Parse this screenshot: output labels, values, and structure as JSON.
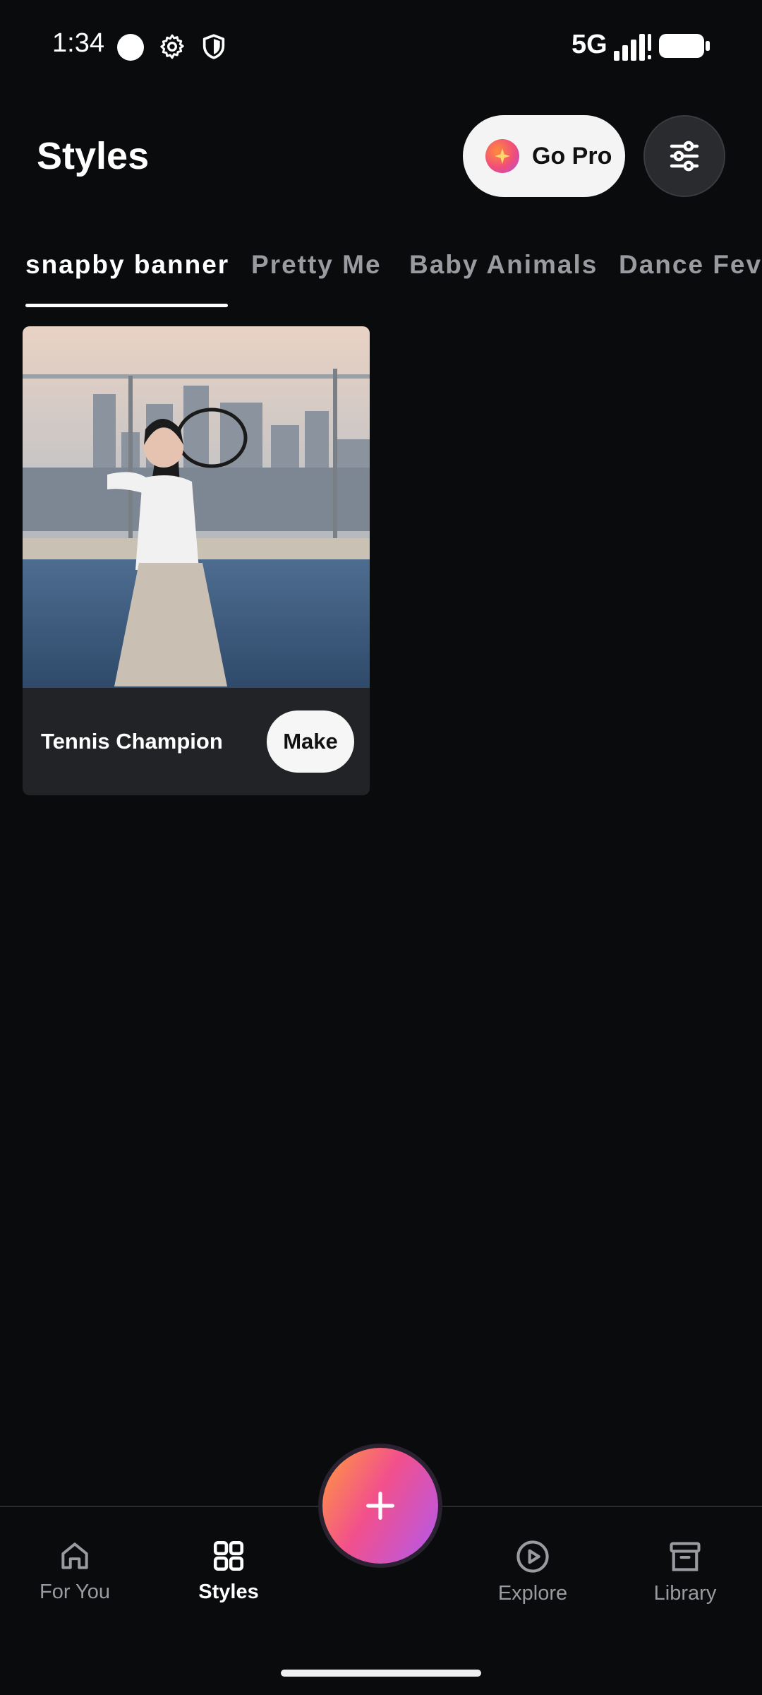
{
  "status_bar": {
    "time": "1:34",
    "network": "5G",
    "icons": [
      "dot-icon",
      "gear-icon",
      "shield-icon",
      "signal-icon",
      "battery-icon"
    ]
  },
  "header": {
    "title": "Styles",
    "go_pro_label": "Go Pro",
    "filter_icon": "sliders-icon"
  },
  "tabs": [
    {
      "label": "snapby banner",
      "active": true
    },
    {
      "label": "Pretty Me",
      "active": false
    },
    {
      "label": "Baby Animals",
      "active": false
    },
    {
      "label": "Dance Fever",
      "active": false
    }
  ],
  "cards": [
    {
      "title": "Tennis Champion",
      "button_label": "Make"
    }
  ],
  "bottom_nav": {
    "items": [
      {
        "label": "For You",
        "icon": "home-icon",
        "active": false
      },
      {
        "label": "Styles",
        "icon": "grid-icon",
        "active": true
      },
      {
        "label": "Explore",
        "icon": "play-circle-icon",
        "active": false
      },
      {
        "label": "Library",
        "icon": "archive-icon",
        "active": false
      }
    ],
    "fab_icon": "plus-icon"
  },
  "colors": {
    "background": "#0a0b0d",
    "accent_gradient_start": "#ff9a3d",
    "accent_gradient_mid": "#f2508c",
    "accent_gradient_end": "#b159f0"
  }
}
